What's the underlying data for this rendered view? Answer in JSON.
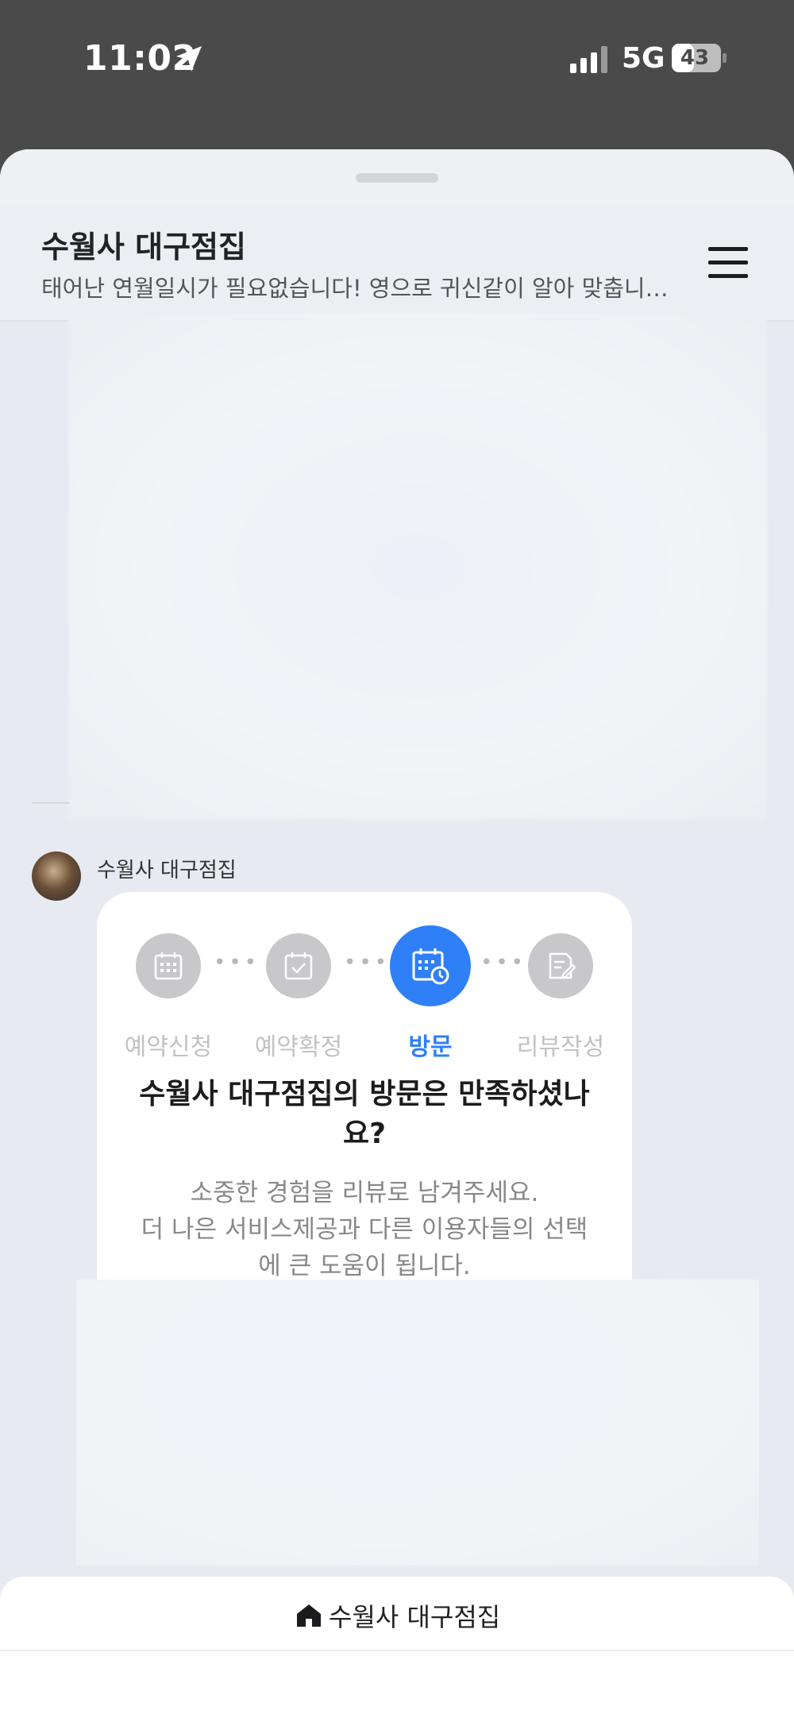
{
  "status_bar": {
    "time": "11:02",
    "network": "5G",
    "battery": "43",
    "icons": [
      "location-arrow-icon",
      "signal-icon",
      "battery-icon"
    ]
  },
  "header": {
    "title": "수월사 대구점집",
    "description": "태어난 연월일시가 필요없습니다! 영으로 귀신같이 알아 맞춥니다! 묻...",
    "menu_icon": "hamburger-menu-icon"
  },
  "message": {
    "sender": "수월사 대구점집",
    "steps": [
      {
        "label": "예약신청",
        "icon": "calendar-grid-icon",
        "active": false
      },
      {
        "label": "예약확정",
        "icon": "calendar-check-icon",
        "active": false
      },
      {
        "label": "방문",
        "icon": "calendar-clock-icon",
        "active": true
      },
      {
        "label": "리뷰작성",
        "icon": "review-edit-icon",
        "active": false
      }
    ],
    "title_line1": "수월사 대구점집의 방문은 만족하셨나",
    "title_line2": "요?",
    "desc_line1": "소중한 경험을 리뷰로 남겨주세요.",
    "desc_line2": "더 나은 서비스제공과 다른 이용자들의 선택",
    "desc_line3": "에 큰 도움이 됩니다."
  },
  "bottom_bar": {
    "label": "수월사 대구점집",
    "icon": "home-icon"
  },
  "colors": {
    "accent": "#2f80f7",
    "inactive": "#c8c8ca",
    "background": "#e8eaf1"
  }
}
